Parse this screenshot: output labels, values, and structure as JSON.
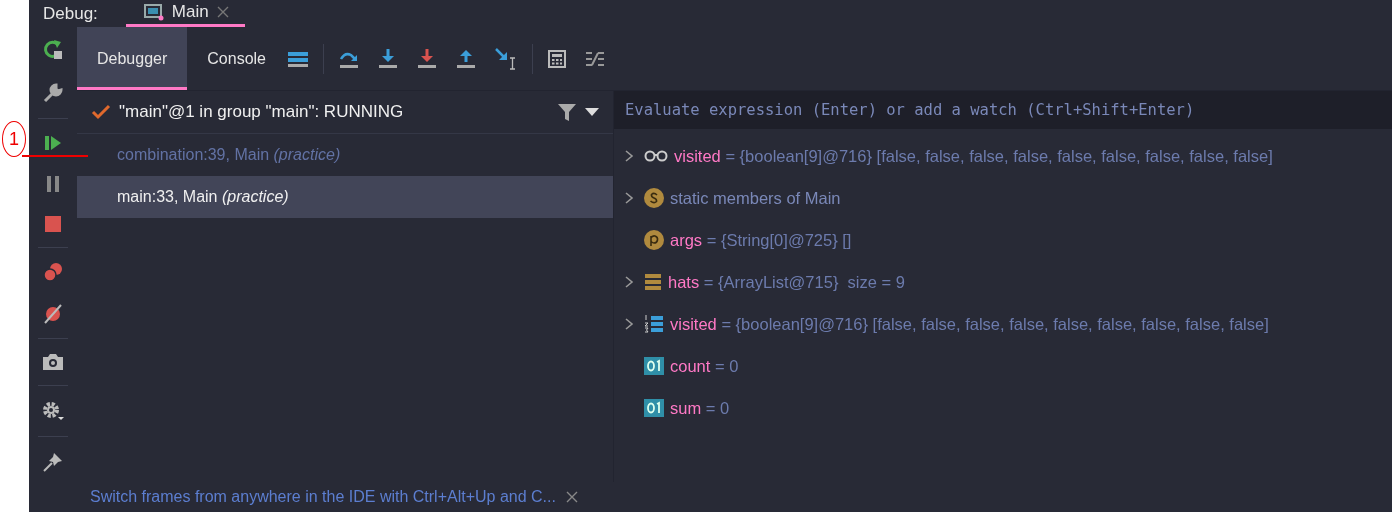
{
  "annotation": {
    "label": "1"
  },
  "header": {
    "title": "Debug:",
    "tab": {
      "label": "Main",
      "selected": true
    }
  },
  "tabs": [
    {
      "label": "Debugger",
      "selected": true
    },
    {
      "label": "Console",
      "selected": false
    }
  ],
  "thread": {
    "label": "\"main\"@1 in group \"main\": RUNNING"
  },
  "frames": [
    {
      "label": "combination:39, Main *(practice)*",
      "selected": false
    },
    {
      "label": "main:33, Main *(practice)*",
      "selected": true
    }
  ],
  "evaluate": {
    "placeholder": "Evaluate expression (Enter) or add a watch (Ctrl+Shift+Enter)"
  },
  "variables": [
    {
      "kind": "watch",
      "expandable": true,
      "name": "visited",
      "value": "= {boolean[9]@716} [false, false, false, false, false, false, false, false, false]"
    },
    {
      "kind": "static",
      "expandable": true,
      "label": "static members of Main"
    },
    {
      "kind": "param",
      "expandable": false,
      "name": "args",
      "value": "= {String[0]@725} []"
    },
    {
      "kind": "list",
      "expandable": true,
      "name": "hats",
      "value": "= {ArrayList@715}  size = 9"
    },
    {
      "kind": "array",
      "expandable": true,
      "name": "visited",
      "value": "= {boolean[9]@716} [false, false, false, false, false, false, false, false, false]"
    },
    {
      "kind": "primitive",
      "expandable": false,
      "name": "count",
      "value": "= 0"
    },
    {
      "kind": "primitive",
      "expandable": false,
      "name": "sum",
      "value": "= 0"
    }
  ],
  "hint": {
    "text": "Switch frames from anywhere in the IDE with Ctrl+Alt+Up and C..."
  }
}
